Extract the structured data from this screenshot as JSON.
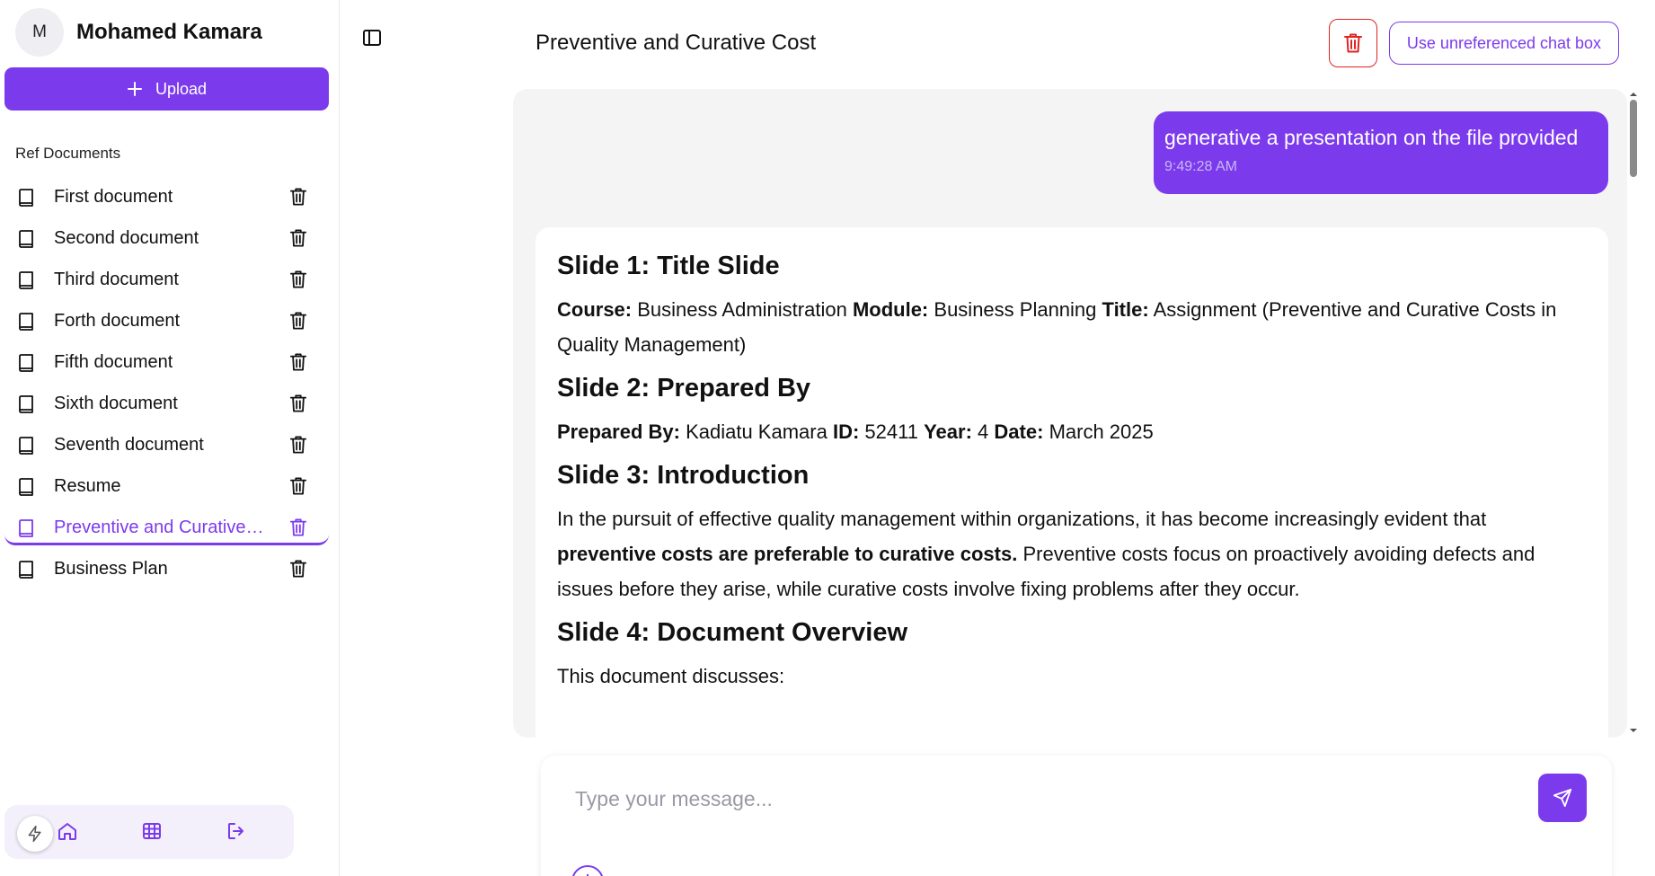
{
  "user": {
    "initial": "M",
    "name": "Mohamed Kamara"
  },
  "sidebar": {
    "upload_label": "Upload",
    "ref_label": "Ref Documents",
    "documents": [
      {
        "label": "First document"
      },
      {
        "label": "Second document"
      },
      {
        "label": "Third document"
      },
      {
        "label": "Forth document"
      },
      {
        "label": "Fifth document"
      },
      {
        "label": "Sixth document"
      },
      {
        "label": "Seventh document"
      },
      {
        "label": "Resume"
      },
      {
        "label": "Preventive and Curative Cost"
      },
      {
        "label": "Business Plan"
      }
    ],
    "active_index": 8,
    "bottom_nav": [
      "bolt-icon",
      "home-icon",
      "table-icon",
      "logout-icon"
    ]
  },
  "header": {
    "title": "Preventive and Curative Cost",
    "unref_button": "Use unreferenced chat box"
  },
  "chat": {
    "user_message": {
      "text": "generative a presentation on the file provided",
      "time": "9:49:28 AM"
    },
    "bot_message": {
      "s1_title": "Slide 1: Title Slide",
      "s1_course_label": "Course:",
      "s1_course": "Business Administration",
      "s1_module_label": "Module:",
      "s1_module": "Business Planning",
      "s1_title_label": "Title:",
      "s1_title_value": "Assignment (Preventive and Curative Costs in Quality Management)",
      "s2_title": "Slide 2: Prepared By",
      "s2_prepared_label": "Prepared By:",
      "s2_prepared": "Kadiatu Kamara",
      "s2_id_label": "ID:",
      "s2_id": "52411",
      "s2_year_label": "Year:",
      "s2_year": "4",
      "s2_date_label": "Date:",
      "s2_date": "March 2025",
      "s3_title": "Slide 3: Introduction",
      "s3_text_a": "In the pursuit of effective quality management within organizations, it has become increasingly evident that",
      "s3_bold": "preventive costs are preferable to curative costs.",
      "s3_text_b": "Preventive costs focus on proactively avoiding defects and issues before they arise, while curative costs involve fixing problems after they occur.",
      "s4_title": "Slide 4: Document Overview",
      "s4_text": "This document discusses:"
    }
  },
  "composer": {
    "placeholder": "Type your message..."
  },
  "colors": {
    "accent": "#7c3aed",
    "danger": "#e02424",
    "chat_bg": "#f4f4f5"
  }
}
